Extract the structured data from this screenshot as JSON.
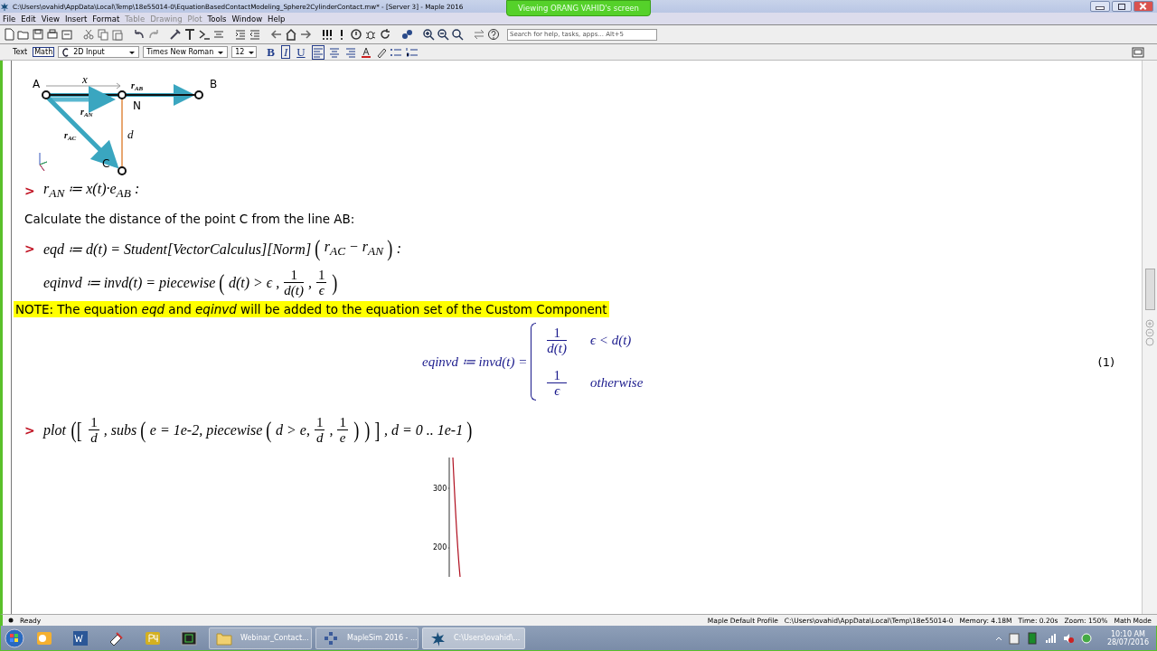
{
  "window": {
    "title": "C:\\Users\\ovahid\\AppData\\Local\\Temp\\18e55014-0\\EquationBasedContactModeling_Sphere2CylinderContact.mw* - [Server 3] - Maple 2016",
    "banner": "Viewing ORANG VAHID's screen"
  },
  "menu": [
    {
      "label": "File",
      "disabled": false
    },
    {
      "label": "Edit",
      "disabled": false
    },
    {
      "label": "View",
      "disabled": false
    },
    {
      "label": "Insert",
      "disabled": false
    },
    {
      "label": "Format",
      "disabled": false
    },
    {
      "label": "Table",
      "disabled": true
    },
    {
      "label": "Drawing",
      "disabled": true
    },
    {
      "label": "Plot",
      "disabled": true
    },
    {
      "label": "Tools",
      "disabled": false
    },
    {
      "label": "Window",
      "disabled": false
    },
    {
      "label": "Help",
      "disabled": false
    }
  ],
  "toolbar": {
    "search": {
      "placeholder": "Search for help, tasks, apps... Alt+5"
    }
  },
  "format_bar": {
    "modes": [
      {
        "label": "Text",
        "selected": false
      },
      {
        "label": "Math",
        "selected": true
      }
    ],
    "style": "2D Input",
    "font": "Times New Roman",
    "size": "12",
    "emphasis": [
      {
        "label": "B",
        "kind": "bold",
        "selected": false
      },
      {
        "label": "I",
        "kind": "italic",
        "selected": true
      },
      {
        "label": "U",
        "kind": "underline",
        "selected": false
      }
    ],
    "alignment": [
      {
        "selected": true
      },
      {
        "selected": false
      },
      {
        "selected": false
      }
    ]
  },
  "document": {
    "diagram": {
      "points": [
        {
          "label": "A"
        },
        {
          "label": "B"
        },
        {
          "label": "N"
        },
        {
          "label": "C"
        }
      ],
      "labels": [
        {
          "text": "x"
        },
        {
          "text": "r",
          "sub": "AB"
        },
        {
          "text": "r",
          "sub": "AN"
        },
        {
          "text": "r",
          "sub": "AC"
        },
        {
          "text": "d"
        }
      ]
    },
    "blocks": [
      {
        "kind": "input",
        "prompt": ">",
        "parts": [
          {
            "kind": "text",
            "text": "r$_{AN}$ ≔ x(t)·e$_{AB}$ :"
          }
        ]
      },
      {
        "kind": "paragraph",
        "text": "Calculate the distance of the point C from the line AB:"
      },
      {
        "kind": "input",
        "prompt": ">",
        "parts": [
          {
            "kind": "text",
            "text": "eqd ≔ d(t) = Student[VectorCalculus][Norm]"
          },
          {
            "kind": "delimiter",
            "text": "("
          },
          {
            "kind": "text",
            "text": "r$_{AC}$ − r$_{AN}$"
          },
          {
            "kind": "delimiter",
            "text": ")"
          },
          {
            "kind": "text",
            "text": " :"
          }
        ]
      },
      {
        "kind": "input",
        "parts": [
          {
            "kind": "text",
            "text": "eqinvd ≔ invd(t) = piecewise"
          },
          {
            "kind": "delimiter",
            "text": "("
          },
          {
            "kind": "text",
            "text": "d(t) > ϵ ,"
          },
          {
            "kind": "fraction",
            "num": "1",
            "den": "d(t)"
          },
          {
            "kind": "text",
            "text": ","
          },
          {
            "kind": "fraction",
            "num": "1",
            "den": "ϵ"
          },
          {
            "kind": "delimiter",
            "text": ")"
          }
        ]
      },
      {
        "kind": "note",
        "text": "NOTE: The equation *eqd* and *eqinvd* will be added to the equation set of the Custom Component"
      },
      {
        "kind": "output",
        "lhs": "eqinvd ≔ invd(t) =",
        "cases": [
          {
            "num": "1",
            "den": "d(t)",
            "condition": "ϵ < d(t)"
          },
          {
            "num": "1",
            "den": "ϵ",
            "condition": "otherwise"
          }
        ],
        "label": "(1)"
      },
      {
        "kind": "input",
        "prompt": ">",
        "parts": [
          {
            "kind": "text",
            "text": "plot"
          },
          {
            "kind": "delimiter",
            "text": "(["
          },
          {
            "kind": "fraction",
            "num": "1",
            "den": "d"
          },
          {
            "kind": "text",
            "text": ", subs"
          },
          {
            "kind": "delimiter",
            "text": "("
          },
          {
            "kind": "text",
            "text": "e = 1e-2, piecewise"
          },
          {
            "kind": "delimiter",
            "text": "("
          },
          {
            "kind": "text",
            "text": "d > e,"
          },
          {
            "kind": "fraction",
            "num": "1",
            "den": "d"
          },
          {
            "kind": "text",
            "text": ","
          },
          {
            "kind": "fraction",
            "num": "1",
            "den": "e"
          },
          {
            "kind": "delimiter",
            "text": ")"
          },
          {
            "kind": "delimiter",
            "text": ")"
          },
          {
            "kind": "delimiter",
            "text": "]"
          },
          {
            "kind": "text",
            "text": ", d = 0 .. 1e-1"
          },
          {
            "kind": "delimiter",
            "text": ")"
          }
        ]
      },
      {
        "kind": "plot",
        "y_tick_labels": [
          "300",
          "200"
        ]
      }
    ]
  },
  "status_bar": {
    "state": "Ready",
    "profile": "Maple Default Profile",
    "path": "C:\\Users\\ovahid\\AppData\\Local\\Temp\\18e55014-0",
    "memory": "Memory: 4.18M",
    "time": "Time: 0.20s",
    "zoom": "Zoom: 150%",
    "mode": "Math Mode"
  },
  "taskbar": {
    "tasks": [
      {
        "label": "Webinar_Contact...",
        "kind": "folder",
        "selected": false
      },
      {
        "label": "MapleSim 2016 - ...",
        "kind": "maplesim",
        "selected": false
      },
      {
        "label": "C:\\Users\\ovahid\\...",
        "kind": "maple",
        "selected": true
      }
    ],
    "clock": {
      "time": "10:10 AM",
      "date": "28/07/2016"
    }
  }
}
